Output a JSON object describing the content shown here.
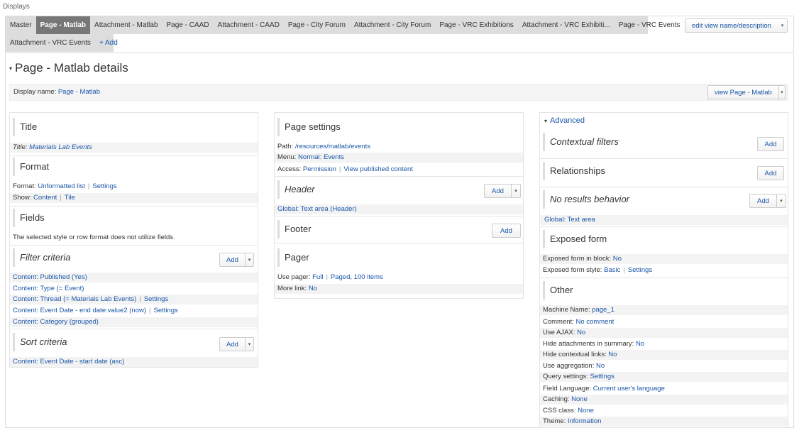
{
  "displays_label": "Displays",
  "tabs_row1": [
    "Master",
    "Page - Matlab",
    "Attachment - Matlab",
    "Page - CAAD",
    "Attachment - CAAD",
    "Page - City Forum",
    "Attachment - City Forum",
    "Page - VRC Exhibitions",
    "Attachment - VRC Exhibiti...",
    "Page - VRC Events"
  ],
  "tabs_row2": [
    "Attachment - VRC Events"
  ],
  "add_tab": "+ Add",
  "edit_view_button": "edit view name/description",
  "details_title": "Page - Matlab details",
  "display_name": {
    "label": "Display name:",
    "value": "Page - Matlab"
  },
  "view_page_button": "view Page - Matlab",
  "add_label": "Add",
  "col1": {
    "title": {
      "heading": "Title",
      "label": "Title:",
      "value": "Materials Lab Events"
    },
    "format": {
      "heading": "Format",
      "format_label": "Format:",
      "format_value": "Unformatted list",
      "format_settings": "Settings",
      "show_label": "Show:",
      "show_value": "Content",
      "show_extra": "Tile"
    },
    "fields": {
      "heading": "Fields",
      "note": "The selected style or row format does not utilize fields."
    },
    "filter": {
      "heading": "Filter criteria",
      "items": [
        "Content: Published (Yes)",
        "Content: Type (= Event)",
        "Content: Thread (= Materials Lab Events)",
        "Content: Event Date - end date:value2 (now)",
        "Content: Category (grouped)"
      ],
      "settings": "Settings"
    },
    "sort": {
      "heading": "Sort criteria",
      "items": [
        "Content: Event Date - start date (asc)"
      ]
    }
  },
  "col2": {
    "page_settings": {
      "heading": "Page settings",
      "path_label": "Path:",
      "path_value": "/resources/matlab/events",
      "menu_label": "Menu:",
      "menu_value": "Normal: Events",
      "access_label": "Access:",
      "access_value": "Permission",
      "access_extra": "View published content"
    },
    "header": {
      "heading": "Header",
      "item": "Global: Text area (Header)"
    },
    "footer": {
      "heading": "Footer"
    },
    "pager": {
      "heading": "Pager",
      "use_label": "Use pager:",
      "use_value": "Full",
      "use_extra": "Paged, 100 items",
      "more_label": "More link:",
      "more_value": "No"
    }
  },
  "col3": {
    "advanced": "Advanced",
    "contextual": {
      "heading": "Contextual filters"
    },
    "relationships": {
      "heading": "Relationships"
    },
    "no_results": {
      "heading": "No results behavior",
      "item": "Global: Text area"
    },
    "exposed": {
      "heading": "Exposed form",
      "block_label": "Exposed form in block:",
      "block_value": "No",
      "style_label": "Exposed form style:",
      "style_value": "Basic",
      "style_settings": "Settings"
    },
    "other": {
      "heading": "Other",
      "rows": [
        {
          "label": "Machine Name:",
          "value": "page_1"
        },
        {
          "label": "Comment:",
          "value": "No comment"
        },
        {
          "label": "Use AJAX:",
          "value": "No"
        },
        {
          "label": "Hide attachments in summary:",
          "value": "No"
        },
        {
          "label": "Hide contextual links:",
          "value": "No"
        },
        {
          "label": "Use aggregation:",
          "value": "No"
        },
        {
          "label": "Query settings:",
          "value": "Settings"
        },
        {
          "label": "Field Language:",
          "value": "Current user's language"
        },
        {
          "label": "Caching:",
          "value": "None"
        },
        {
          "label": "CSS class:",
          "value": "None"
        },
        {
          "label": "Theme:",
          "value": "Information"
        }
      ]
    }
  }
}
